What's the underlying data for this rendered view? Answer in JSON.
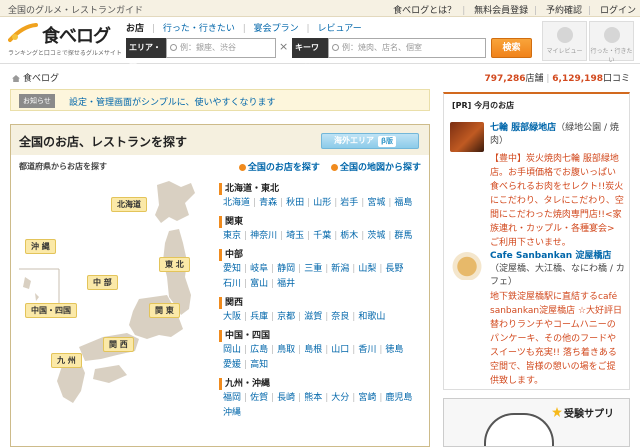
{
  "topbar": {
    "tagline": "全国のグルメ・レストランガイド",
    "links": [
      "食べログとは？",
      "無料会員登録",
      "予約確認",
      "ログイン"
    ]
  },
  "logo": {
    "name": "食べログ",
    "tagline": "ランキングと口コミで探せるグルメサイト"
  },
  "search": {
    "tabs": [
      "お店",
      "行った・行きたい",
      "宴会プラン",
      "レビュアー"
    ],
    "area_label": "エリア・駅",
    "area_placeholder": "例：銀座、渋谷",
    "clear": "×",
    "keyword_label": "キーワード",
    "keyword_placeholder": "例：焼肉、店名、個室",
    "button": "検索"
  },
  "header_icons": [
    "マイレビュー",
    "行った・行きたい"
  ],
  "breadcrumb": "食べログ",
  "stats": {
    "shops_count": "797,286",
    "shops_unit": "店舗",
    "reviews_count": "6,129,198",
    "reviews_unit": "口コミ"
  },
  "notice": {
    "badge": "お知らせ",
    "message": "設定・管理画面がシンプルに、使いやすくなります"
  },
  "panel": {
    "title": "全国のお店、レストランを探す",
    "overseas": "海外エリア",
    "beta": "β版",
    "map_heading": "都道府県からお店を探す",
    "link_all": "全国のお店を探す",
    "link_map": "全国の地図から探す"
  },
  "map_labels": [
    "北海道",
    "東 北",
    "沖 縄",
    "中 部",
    "関 東",
    "中国・四国",
    "関 西",
    "九 州"
  ],
  "regions": [
    {
      "name": "北海道・東北",
      "prefs": [
        "北海道",
        "青森",
        "秋田",
        "山形",
        "岩手",
        "宮城",
        "福島"
      ]
    },
    {
      "name": "関東",
      "prefs": [
        "東京",
        "神奈川",
        "埼玉",
        "千葉",
        "栃木",
        "茨城",
        "群馬"
      ]
    },
    {
      "name": "中部",
      "prefs": [
        "愛知",
        "岐阜",
        "静岡",
        "三重",
        "新潟",
        "山梨",
        "長野",
        "石川",
        "富山",
        "福井"
      ]
    },
    {
      "name": "関西",
      "prefs": [
        "大阪",
        "兵庫",
        "京都",
        "滋賀",
        "奈良",
        "和歌山"
      ]
    },
    {
      "name": "中国・四国",
      "prefs": [
        "岡山",
        "広島",
        "鳥取",
        "島根",
        "山口",
        "香川",
        "徳島",
        "愛媛",
        "高知"
      ]
    },
    {
      "name": "九州・沖縄",
      "prefs": [
        "福岡",
        "佐賀",
        "長崎",
        "熊本",
        "大分",
        "宮崎",
        "鹿児島",
        "沖縄"
      ]
    }
  ],
  "pr": {
    "title": "[PR] 今月のお店",
    "items": [
      {
        "name": "七輪 服部緑地店",
        "area": "（緑地公園 / 焼肉）",
        "desc": "【豊中】炭火焼肉七輪 服部緑地店。お手頃価格でお腹いっぱい食べられるお肉をセレクト!!炭火にこだわり、タレにこだわり、空間にこだわった焼肉専門店!!<家族連れ・カップル・各種宴会> ご利用下さいませ。"
      },
      {
        "name": "Cafe Sanbankan 淀屋橋店",
        "area": "（淀屋橋、大江橋、なにわ橋 / カフェ）",
        "desc": "地下鉄淀屋橋駅に直結するcafé sanbankan淀屋橋店 ☆大好評日替わりランチやコームハニーのパンケーキ、その他のフードやスイーツも充実!! 落ち着きある空間で、皆様の憩いの場をご提供致します。"
      }
    ]
  },
  "ad": {
    "text": "受験サプリ"
  }
}
